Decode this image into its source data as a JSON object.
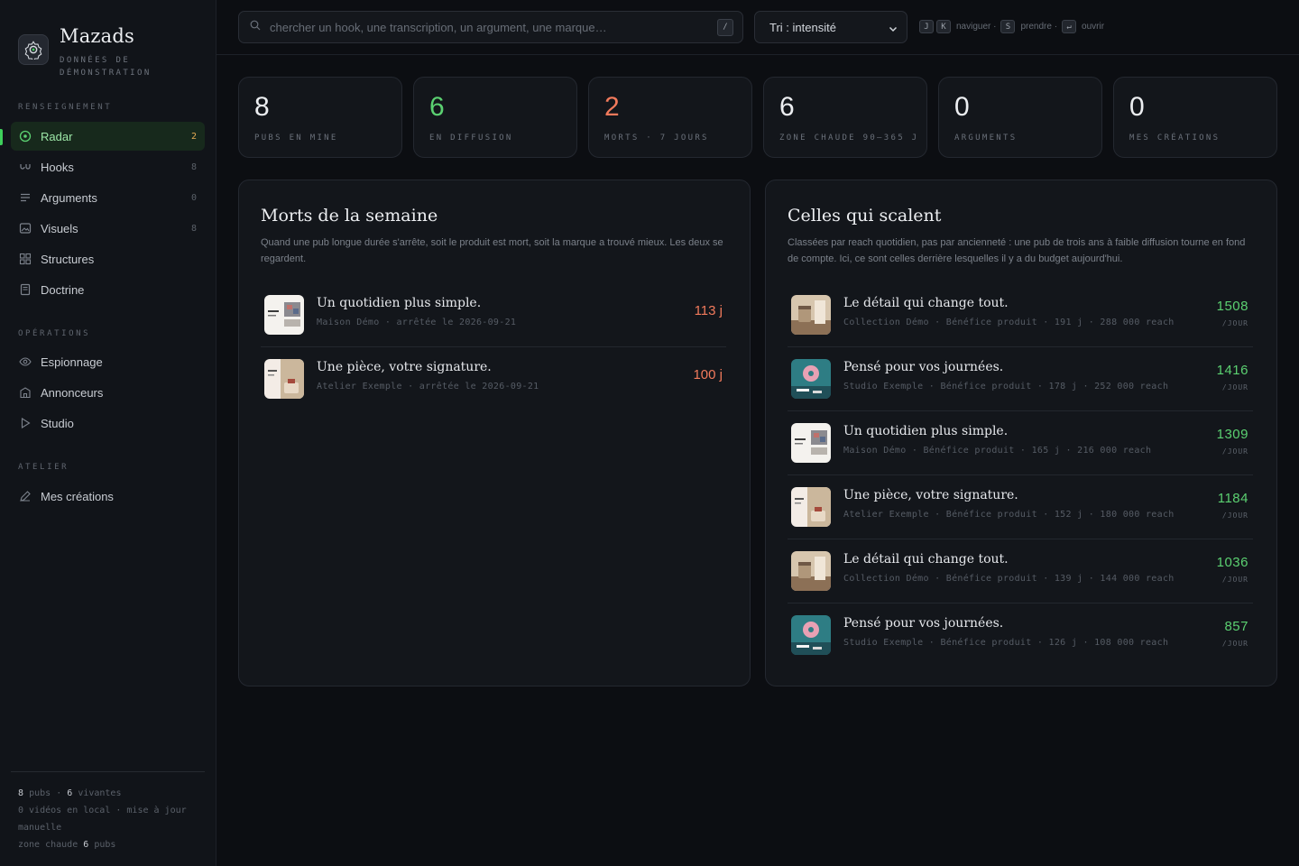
{
  "brand": {
    "name": "Mazads",
    "subtitle": "DONNÉES DE DÉMONSTRATION"
  },
  "sidebar": {
    "sections": [
      {
        "title": "RENSEIGNEMENT"
      },
      {
        "title": "OPÉRATIONS"
      },
      {
        "title": "ATELIER"
      }
    ],
    "items": [
      {
        "label": "Radar",
        "count": "2",
        "icon": "radar-icon"
      },
      {
        "label": "Hooks",
        "count": "8",
        "icon": "hook-icon"
      },
      {
        "label": "Arguments",
        "count": "0",
        "icon": "lines-icon"
      },
      {
        "label": "Visuels",
        "count": "8",
        "icon": "image-icon"
      },
      {
        "label": "Structures",
        "count": "",
        "icon": "grid-icon"
      },
      {
        "label": "Doctrine",
        "count": "",
        "icon": "book-icon"
      },
      {
        "label": "Espionnage",
        "count": "",
        "icon": "eye-icon"
      },
      {
        "label": "Annonceurs",
        "count": "",
        "icon": "building-icon"
      },
      {
        "label": "Studio",
        "count": "",
        "icon": "play-icon"
      },
      {
        "label": "Mes créations",
        "count": "",
        "icon": "pen-icon"
      }
    ],
    "footer": {
      "pubs_count": "8",
      "pubs_label": "pubs",
      "sep": "·",
      "alive_count": "6",
      "alive_label": "vivantes",
      "line2": "0 vidéos en local · mise à jour manuelle",
      "zone_label": "zone chaude",
      "zone_count": "6",
      "zone_unit": "pubs"
    }
  },
  "search": {
    "placeholder": "chercher un hook, une transcription, un argument, une marque…",
    "shortcut": "/"
  },
  "sort": {
    "selected": "Tri : intensité"
  },
  "hints": [
    {
      "keys": [
        "J",
        "K"
      ],
      "label": "naviguer ·"
    },
    {
      "keys": [
        "S"
      ],
      "label": "prendre ·"
    },
    {
      "keys": [
        "↵"
      ],
      "label": "ouvrir"
    }
  ],
  "stats": [
    {
      "value": "8",
      "label": "PUBS EN MINE",
      "color": "#eceef1"
    },
    {
      "value": "6",
      "label": "EN DIFFUSION",
      "color": "#5bd071"
    },
    {
      "value": "2",
      "label": "MORTS · 7 JOURS",
      "color": "#f27a5c"
    },
    {
      "value": "6",
      "label": "ZONE CHAUDE 90–365 J",
      "color": "#eceef1"
    },
    {
      "value": "0",
      "label": "ARGUMENTS",
      "color": "#eceef1"
    },
    {
      "value": "0",
      "label": "MES CRÉATIONS",
      "color": "#eceef1"
    }
  ],
  "deaths": {
    "title": "Morts de la semaine",
    "desc": "Quand une pub longue durée s'arrête, soit le produit est mort, soit la marque a trouvé mieux. Les deux se regardent.",
    "rows": [
      {
        "title": "Un quotidien plus simple.",
        "meta": "Maison Démo · arrêtée le 2026-09-21",
        "value": "113 j",
        "thumb": "collage"
      },
      {
        "title": "Une pièce, votre signature.",
        "meta": "Atelier Exemple · arrêtée le 2026-09-21",
        "value": "100 j",
        "thumb": "cake"
      }
    ]
  },
  "scaling": {
    "title": "Celles qui scalent",
    "desc": "Classées par reach quotidien, pas par ancienneté : une pub de trois ans à faible diffusion tourne en fond de compte. Ici, ce sont celles derrière lesquelles il y a du budget aujourd'hui.",
    "unit": "/JOUR",
    "rows": [
      {
        "title": "Le détail qui change tout.",
        "meta": "Collection Démo · Bénéfice produit · 191 j · 288 000 reach",
        "value": "1508",
        "thumb": "interior"
      },
      {
        "title": "Pensé pour vos journées.",
        "meta": "Studio Exemple · Bénéfice produit · 178 j · 252 000 reach",
        "value": "1416",
        "thumb": "donut"
      },
      {
        "title": "Un quotidien plus simple.",
        "meta": "Maison Démo · Bénéfice produit · 165 j · 216 000 reach",
        "value": "1309",
        "thumb": "collage"
      },
      {
        "title": "Une pièce, votre signature.",
        "meta": "Atelier Exemple · Bénéfice produit · 152 j · 180 000 reach",
        "value": "1184",
        "thumb": "cake"
      },
      {
        "title": "Le détail qui change tout.",
        "meta": "Collection Démo · Bénéfice produit · 139 j · 144 000 reach",
        "value": "1036",
        "thumb": "interior"
      },
      {
        "title": "Pensé pour vos journées.",
        "meta": "Studio Exemple · Bénéfice produit · 126 j · 108 000 reach",
        "value": "857",
        "thumb": "donut"
      }
    ]
  }
}
